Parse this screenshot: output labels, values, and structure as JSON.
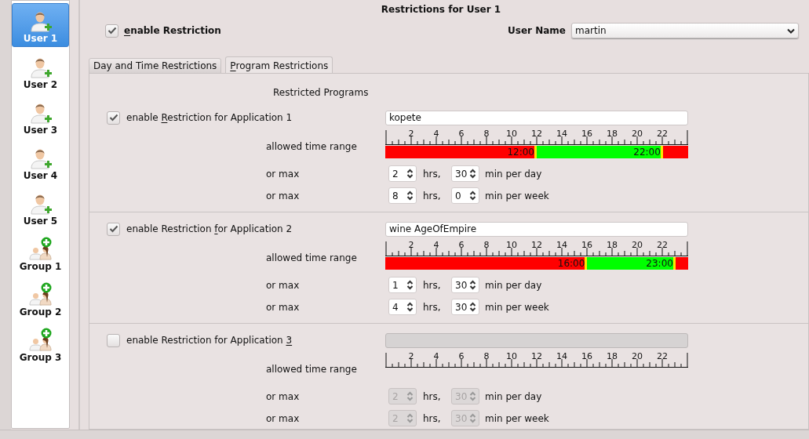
{
  "sidebar": {
    "items": [
      {
        "label": "User 1",
        "kind": "user",
        "selected": true
      },
      {
        "label": "User 2",
        "kind": "user",
        "selected": false
      },
      {
        "label": "User 3",
        "kind": "user",
        "selected": false
      },
      {
        "label": "User 4",
        "kind": "user",
        "selected": false
      },
      {
        "label": "User 5",
        "kind": "user",
        "selected": false
      },
      {
        "label": "Group 1",
        "kind": "group",
        "selected": false
      },
      {
        "label": "Group 2",
        "kind": "group",
        "selected": false
      },
      {
        "label": "Group 3",
        "kind": "group",
        "selected": false
      }
    ]
  },
  "title": "Restrictions for User 1",
  "enable_restriction": {
    "label_parts": [
      {
        "text": "e",
        "mnemonic": true
      },
      {
        "text": "nable Restriction",
        "mnemonic": false
      }
    ],
    "checked": true
  },
  "user_name": {
    "label": "User Name",
    "value": "martin"
  },
  "tabs": [
    {
      "label_parts": [
        {
          "text": "Day and Time Restrictions",
          "mnemonic": false
        }
      ],
      "selected": false
    },
    {
      "label_parts": [
        {
          "text": "P",
          "mnemonic": true
        },
        {
          "text": "rogram Restrictions",
          "mnemonic": false
        }
      ],
      "selected": true
    }
  ],
  "section_title": "Restricted Programs",
  "apps": [
    {
      "label_parts": [
        {
          "text": "enable ",
          "mnemonic": false
        },
        {
          "text": "R",
          "mnemonic": true
        },
        {
          "text": "estriction for Application 1",
          "mnemonic": false
        }
      ],
      "checked": true,
      "program": "kopete",
      "range_label": "allowed time range",
      "scale": [
        "2",
        "4",
        "6",
        "8",
        "10",
        "12",
        "14",
        "16",
        "18",
        "20",
        "22"
      ],
      "range": {
        "start": {
          "label": "12:00",
          "level": 0.5
        },
        "end": {
          "label": "22:00",
          "level": 0.9167
        }
      },
      "limits": [
        {
          "prefix": "or max",
          "hours": "2",
          "hours_unit": "hrs,",
          "minutes": "30",
          "minutes_unit": "min per day"
        },
        {
          "prefix": "or max",
          "hours": "8",
          "hours_unit": "hrs,",
          "minutes": "0",
          "minutes_unit": "min per week"
        }
      ]
    },
    {
      "label_parts": [
        {
          "text": "enable Restriction ",
          "mnemonic": false
        },
        {
          "text": "f",
          "mnemonic": true
        },
        {
          "text": "or Application 2",
          "mnemonic": false
        }
      ],
      "checked": true,
      "program": "wine AgeOfEmpire",
      "range_label": "allowed time range",
      "scale": [
        "2",
        "4",
        "6",
        "8",
        "10",
        "12",
        "14",
        "16",
        "18",
        "20",
        "22"
      ],
      "range": {
        "start": {
          "label": "16:00",
          "level": 0.6667
        },
        "end": {
          "label": "23:00",
          "level": 0.9583
        }
      },
      "limits": [
        {
          "prefix": "or max",
          "hours": "1",
          "hours_unit": "hrs,",
          "minutes": "30",
          "minutes_unit": "min per day"
        },
        {
          "prefix": "or max",
          "hours": "4",
          "hours_unit": "hrs,",
          "minutes": "30",
          "minutes_unit": "min per week"
        }
      ]
    },
    {
      "label_parts": [
        {
          "text": "enable Restriction for Application ",
          "mnemonic": false
        },
        {
          "text": "3",
          "mnemonic": true
        }
      ],
      "checked": false,
      "range_label": "allowed time range",
      "scale": [
        "2",
        "4",
        "6",
        "8",
        "10",
        "12",
        "14",
        "16",
        "18",
        "20",
        "22"
      ],
      "limits": [
        {
          "prefix": "or max",
          "hours": "2",
          "hours_unit": "hrs,",
          "minutes": "30",
          "minutes_unit": "min per day"
        },
        {
          "prefix": "or max",
          "hours": "2",
          "hours_unit": "hrs,",
          "minutes": "30",
          "minutes_unit": "min per week"
        }
      ]
    }
  ]
}
